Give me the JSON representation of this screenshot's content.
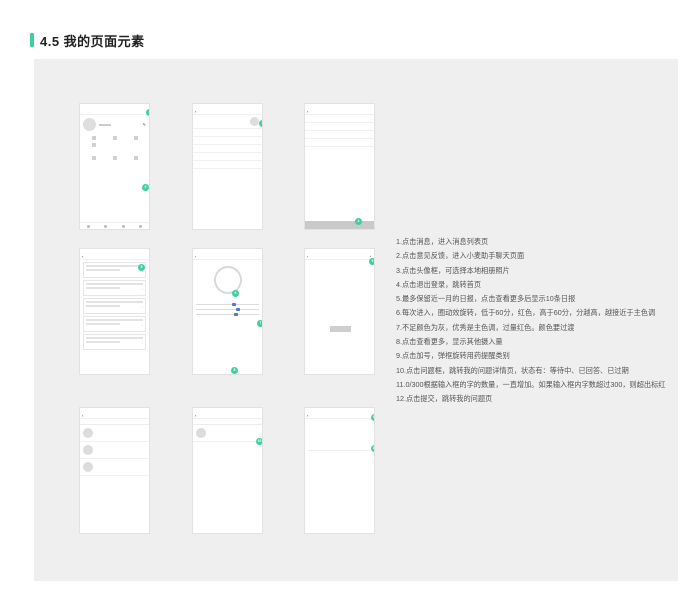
{
  "section": {
    "title": "4.5 我的页面元素",
    "accent_color": "#3ecf9b"
  },
  "instructions": [
    "1.点击消息，进入消息列表页",
    "2.点击意见反馈，进入小麦助手聊天页面",
    "3.点击头像框，可选择本地相册照片",
    "4.点击退出登录，跳转首页",
    "5.最多保留近一月的日报，点击查看更多后显示10条日报",
    "6.每次进入，圈动效旋转，低于60分，红色，高于60分，分越高，越接近于主色调",
    "7.不足颜色为灰，优秀是主色调，过量红色。颜色要过渡",
    "8.点击查看更多，显示其他摄入量",
    "9.点击加号，弹框旋转用药提醒类别",
    "10.点击问题框，跳转我的问题详情页，状态有：等待中、已回答、已过期",
    "11.0/300根据输入框的字的数量，一直增加。如果输入框内字数超过300，则超出标红",
    "12.点击提交，跳转我的问题页"
  ],
  "badges": [
    "1",
    "2",
    "3",
    "4",
    "5",
    "6",
    "7",
    "8",
    "9",
    "10",
    "11",
    "12"
  ]
}
